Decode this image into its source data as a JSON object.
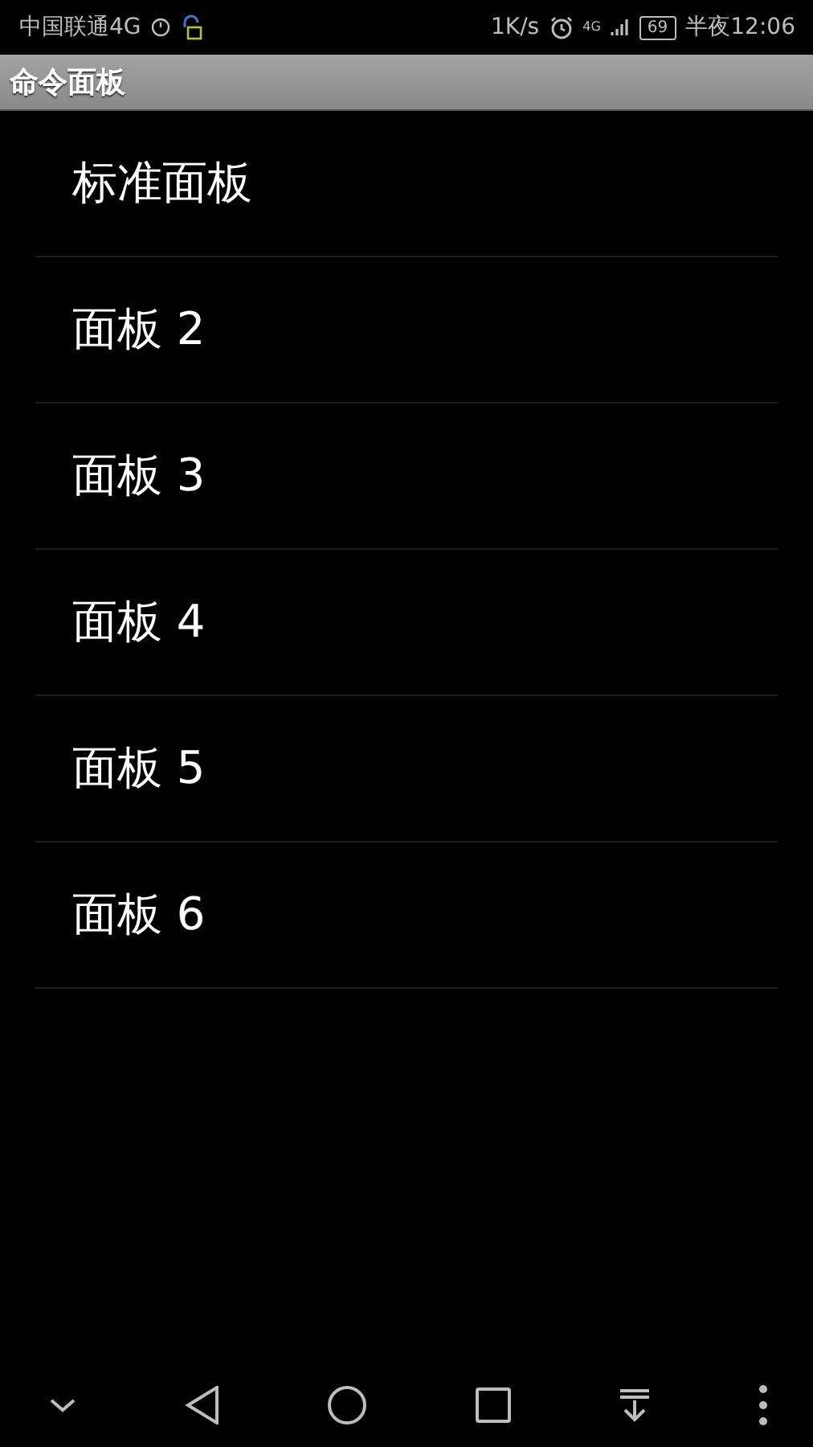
{
  "status_bar": {
    "carrier": "中国联通4G",
    "speed": "1K/s",
    "network": "4G",
    "battery": "69",
    "time": "半夜12:06"
  },
  "title_bar": {
    "title": "命令面板"
  },
  "panels": [
    {
      "label": "标准面板"
    },
    {
      "label": "面板 2"
    },
    {
      "label": "面板 3"
    },
    {
      "label": "面板 4"
    },
    {
      "label": "面板 5"
    },
    {
      "label": "面板 6"
    }
  ]
}
